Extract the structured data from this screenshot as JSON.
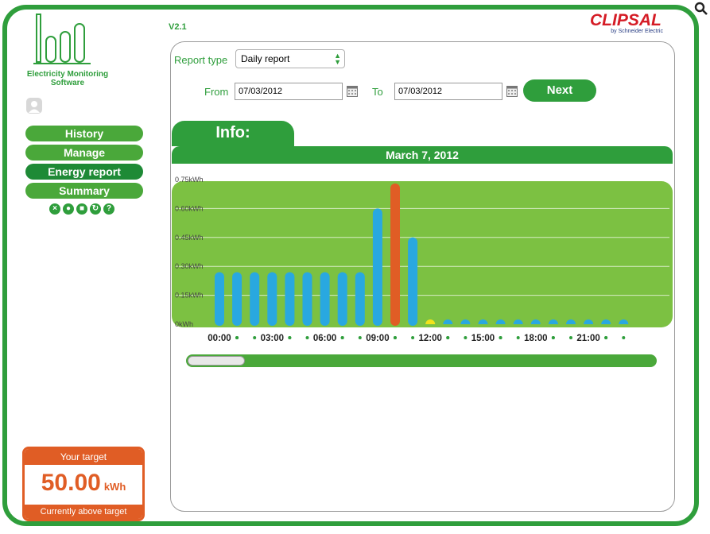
{
  "app": {
    "name_line1": "Electricity Monitoring",
    "name_line2": "Software",
    "version": "V2.1",
    "brand": "CLIPSAL",
    "brand_sub": "by Schneider Electric"
  },
  "sidebar": {
    "items": [
      {
        "label": "History"
      },
      {
        "label": "Manage"
      },
      {
        "label": "Energy report",
        "active": true
      },
      {
        "label": "Summary"
      }
    ],
    "mini_icons": [
      "close-icon",
      "circle-icon",
      "square-icon",
      "refresh-icon",
      "help-icon"
    ],
    "target": {
      "title": "Your target",
      "value": "50.00",
      "unit": "kWh",
      "status": "Currently above target"
    }
  },
  "report": {
    "type_label": "Report type",
    "type_value": "Daily report",
    "from_label": "From",
    "from_value": "07/03/2012",
    "to_label": "To",
    "to_value": "07/03/2012",
    "next_label": "Next"
  },
  "info_tab": "Info:",
  "colors": {
    "green": "#2f9e3c",
    "chart_bg": "#7cc142",
    "bar_blue": "#29a8e0",
    "bar_peak": "#e05d25",
    "bar_yellow": "#f2e31a"
  },
  "chart_data": {
    "type": "bar",
    "title": "March 7, 2012",
    "ylim": [
      0,
      0.75
    ],
    "y_ticks": [
      "0kWh",
      "0.15kWh",
      "0.30kWh",
      "0.45kWh",
      "0.60kWh",
      "0.75kWh"
    ],
    "x_tick_labels": [
      "00:00",
      "03:00",
      "06:00",
      "09:00",
      "12:00",
      "15:00",
      "18:00",
      "21:00"
    ],
    "categories": [
      "00:00",
      "01:00",
      "02:00",
      "03:00",
      "04:00",
      "05:00",
      "06:00",
      "07:00",
      "08:00",
      "09:00",
      "10:00",
      "11:00",
      "12:00",
      "13:00",
      "14:00",
      "15:00",
      "16:00",
      "17:00",
      "18:00",
      "19:00",
      "20:00",
      "21:00",
      "22:00",
      "23:00"
    ],
    "values": [
      0.27,
      0.27,
      0.27,
      0.27,
      0.27,
      0.27,
      0.27,
      0.27,
      0.27,
      0.6,
      0.73,
      0.45,
      0.0,
      0.0,
      0.0,
      0.0,
      0.0,
      0.0,
      0.0,
      0.0,
      0.0,
      0.0,
      0.0,
      0.0
    ],
    "highlight_peak_index": 10,
    "highlight_current_index": 12,
    "grid": true
  }
}
